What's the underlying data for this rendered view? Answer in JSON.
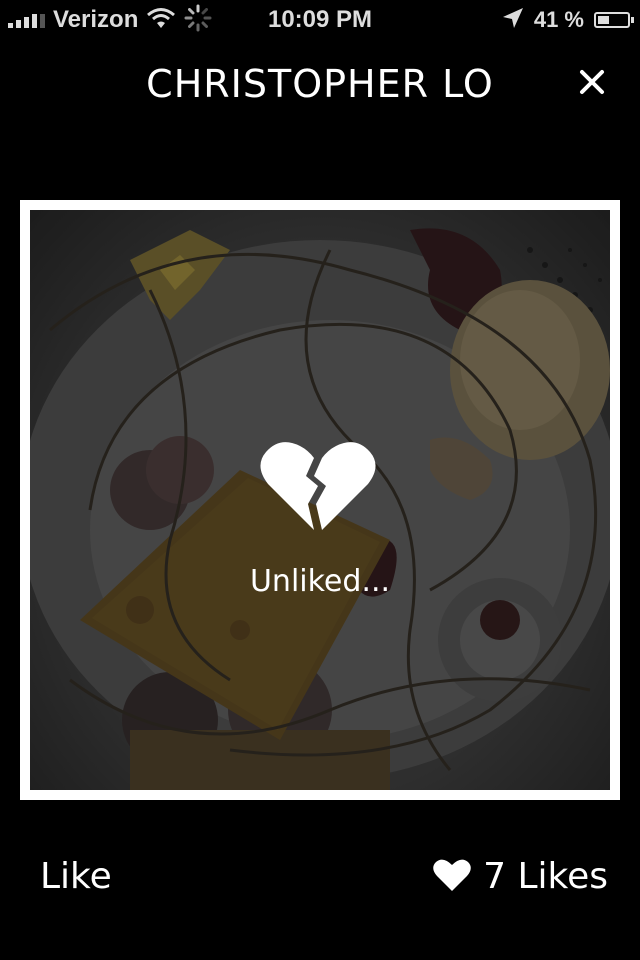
{
  "status_bar": {
    "carrier": "Verizon",
    "time": "10:09 PM",
    "battery_percent": "41 %",
    "battery_level": 0.41,
    "icons": [
      "signal-icon",
      "wifi-icon",
      "activity-spinner-icon",
      "location-arrow-icon",
      "battery-icon"
    ]
  },
  "header": {
    "title": "CHRISTOPHER LO",
    "close_icon": "close-icon"
  },
  "photo": {
    "status_icon": "broken-heart-icon",
    "status_text": "Unliked..."
  },
  "footer": {
    "like_label": "Like",
    "likes_icon": "heart-icon",
    "likes_count": "7 Likes"
  }
}
